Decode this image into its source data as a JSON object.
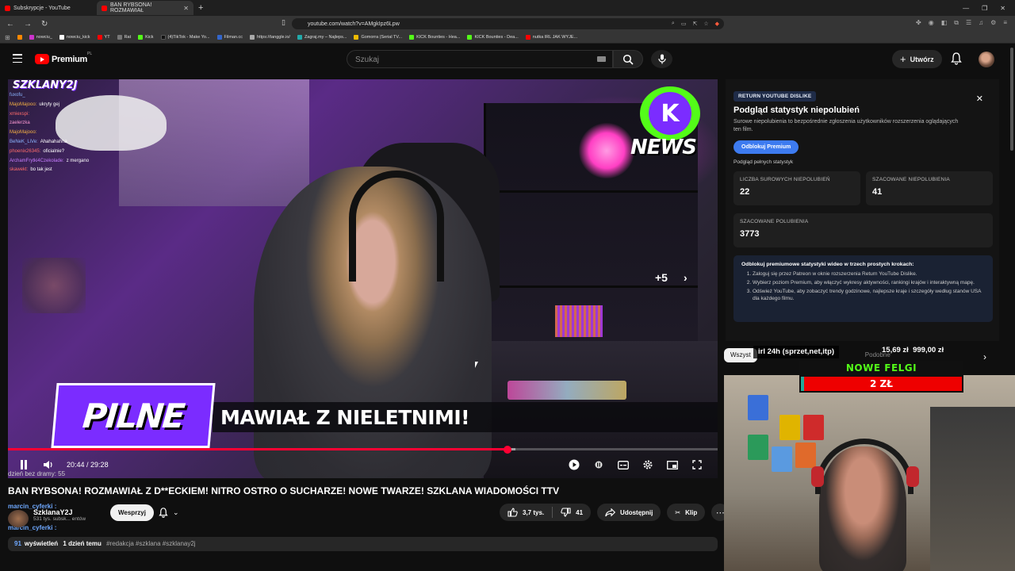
{
  "browser": {
    "tabs": [
      {
        "label": "Subskrypcje - YouTube"
      },
      {
        "label": "BAN RYBSONA! ROZMAWIAŁ"
      }
    ],
    "url": "youtube.com/watch?v=AMgkIpz6Lpw",
    "bookmarks": [
      "nowciu_",
      "nowciu_kick",
      "YT",
      "Rat",
      "Kick",
      "(4)TikTok - Make Yo...",
      "Filman.cc",
      "https://tangglе.io/",
      "Zagraj.my – Najleps...",
      "Gomorra (Serial TV...",
      "KICK Bounties - Hea...",
      "KICK Bounties - Dea...",
      "nutka IRL JAK WYJE..."
    ]
  },
  "header": {
    "logo_text": "Premium",
    "logo_region": "PL",
    "search_placeholder": "Szukaj",
    "create_label": "Utwórz"
  },
  "video": {
    "overlay_chat": {
      "brand": "SZKLANY2J",
      "rows": [
        {
          "user": "fuxofu_",
          "msg": ""
        },
        {
          "user": "MajoMajooo:",
          "msg": "ukryty gej"
        },
        {
          "user": "xmiexspi:",
          "msg": ""
        },
        {
          "user": "zaelerzka",
          "msg": ""
        },
        {
          "user": "MajoMajooo:",
          "msg": ""
        },
        {
          "user": "BeNeK_LiVe:",
          "msg": "Ahahahahha"
        },
        {
          "user": "phoenix26345:",
          "msg": "oficialnie?"
        },
        {
          "user": "ArchamFrytki4Czekolade:",
          "msg": "z mergano"
        },
        {
          "user": "skawekt:",
          "msg": "bo tak jest"
        }
      ]
    },
    "news_logo": "NEWS",
    "more_label": "+5",
    "banner_tag": "PILNE",
    "banner_headline": "MAWIAŁ Z NIELETNIMI!",
    "time_current": "20:44",
    "time_total": "29:28",
    "progress": 0.7035,
    "buffered": 0.715
  },
  "below": {
    "caption": "dzień bez dramy: 55",
    "title": "BAN RYBSONA! ROZMAWIAŁ Z D**ECKIEM! NITRO OSTRO O SUCHARZE! NOWE TWARZE! SZKLANA WIADOMOŚCI TTV",
    "chat_user_1": "marcin_cyferki :",
    "channel_name": "SzklanaY2J",
    "subs": "531 tys. subsk... entów",
    "chat_user_2": "marcin_cyferki :",
    "chat_user_3": "marcin_cyferki :",
    "support_label": "Wesprzyj",
    "likes": "3,7 tys.",
    "dislikes": "41",
    "share": "Udostępnij",
    "clip": "Klip",
    "views_prefix": "91",
    "views": "wyświetleń",
    "date": "1 dzień temu",
    "tags": "#redakcja #szklana #szklanay2j"
  },
  "ryd": {
    "badge": "RETURN YOUTUBE DISLIKE",
    "title": "Podgląd statystyk niepolubień",
    "subtitle": "Surowe niepolubienia to bezpośrednie zgłoszenia użytkowników rozszerzenia oglądających ten film.",
    "unlock": "Odblokuj Premium",
    "full_stats": "Podgląd pełnych statystyk",
    "raw_label": "LICZBA SUROWYCH NIEPOLUBIEŃ",
    "raw_value": "22",
    "est_dislikes_label": "SZACOWANE NIEPOLUBIENIA",
    "est_dislikes_value": "41",
    "est_likes_label": "SZACOWANE POLUBIENIA",
    "est_likes_value": "3773",
    "promo_title": "Odblokuj premiumowe statystyki wideo w trzech prostych krokach:",
    "steps": [
      "Zaloguj się przez Patreon w oknie rozszerzenia Return YouTube Dislike.",
      "Wybierz poziom Premium, aby włączyć wykresy aktywności, rankingi krajów i interaktywną mapę.",
      "Odśwież YouTube, aby zobaczyć trendy godzinowe, najlepsze kraje i szczegóły według stanów USA dla każdego filmu."
    ]
  },
  "chips": {
    "all": "Wszyst",
    "similar": "Podobne"
  },
  "stream_overlay": {
    "goal_label": "irl 24h (sprzet,net,itp)",
    "goal_amount": "15,69 zł",
    "goal_target": "999,00 zł",
    "felgi_title": "NOWE FELGI",
    "felgi_price": "2 ZŁ"
  }
}
